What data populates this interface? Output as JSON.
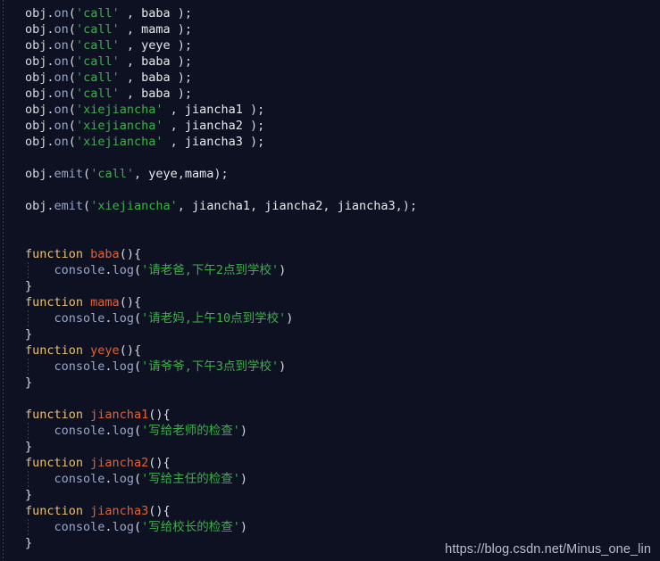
{
  "editor": {
    "theme": "dark-navy",
    "background_color": "#0d1122",
    "language": "javascript",
    "colors": {
      "foreground": "#d7dae3",
      "string": "#3fae4c",
      "keyword": "#e5c07b",
      "function_name": "#e06335",
      "property": "#9aa7c7",
      "indent_guide": "#7a84aa"
    }
  },
  "watermark": {
    "text": "https://blog.csdn.net/Minus_one_lin"
  },
  "code": {
    "lines": [
      {
        "n": 1,
        "indent": false,
        "tokens": [
          {
            "t": "plain",
            "v": "obj"
          },
          {
            "t": "punct",
            "v": "."
          },
          {
            "t": "prop",
            "v": "on"
          },
          {
            "t": "punct",
            "v": "("
          },
          {
            "t": "str",
            "v": "'call'"
          },
          {
            "t": "punct",
            "v": " , "
          },
          {
            "t": "ident",
            "v": "baba"
          },
          {
            "t": "punct",
            "v": " );"
          }
        ]
      },
      {
        "n": 2,
        "indent": false,
        "tokens": [
          {
            "t": "plain",
            "v": "obj"
          },
          {
            "t": "punct",
            "v": "."
          },
          {
            "t": "prop",
            "v": "on"
          },
          {
            "t": "punct",
            "v": "("
          },
          {
            "t": "str",
            "v": "'call'"
          },
          {
            "t": "punct",
            "v": " , "
          },
          {
            "t": "ident",
            "v": "mama"
          },
          {
            "t": "punct",
            "v": " );"
          }
        ]
      },
      {
        "n": 3,
        "indent": false,
        "tokens": [
          {
            "t": "plain",
            "v": "obj"
          },
          {
            "t": "punct",
            "v": "."
          },
          {
            "t": "prop",
            "v": "on"
          },
          {
            "t": "punct",
            "v": "("
          },
          {
            "t": "str",
            "v": "'call'"
          },
          {
            "t": "punct",
            "v": " , "
          },
          {
            "t": "ident",
            "v": "yeye"
          },
          {
            "t": "punct",
            "v": " );"
          }
        ]
      },
      {
        "n": 4,
        "indent": false,
        "tokens": [
          {
            "t": "plain",
            "v": "obj"
          },
          {
            "t": "punct",
            "v": "."
          },
          {
            "t": "prop",
            "v": "on"
          },
          {
            "t": "punct",
            "v": "("
          },
          {
            "t": "str",
            "v": "'call'"
          },
          {
            "t": "punct",
            "v": " , "
          },
          {
            "t": "ident",
            "v": "baba"
          },
          {
            "t": "punct",
            "v": " );"
          }
        ]
      },
      {
        "n": 5,
        "indent": false,
        "tokens": [
          {
            "t": "plain",
            "v": "obj"
          },
          {
            "t": "punct",
            "v": "."
          },
          {
            "t": "prop",
            "v": "on"
          },
          {
            "t": "punct",
            "v": "("
          },
          {
            "t": "str",
            "v": "'call'"
          },
          {
            "t": "punct",
            "v": " , "
          },
          {
            "t": "ident",
            "v": "baba"
          },
          {
            "t": "punct",
            "v": " );"
          }
        ]
      },
      {
        "n": 6,
        "indent": false,
        "tokens": [
          {
            "t": "plain",
            "v": "obj"
          },
          {
            "t": "punct",
            "v": "."
          },
          {
            "t": "prop",
            "v": "on"
          },
          {
            "t": "punct",
            "v": "("
          },
          {
            "t": "str",
            "v": "'call'"
          },
          {
            "t": "punct",
            "v": " , "
          },
          {
            "t": "ident",
            "v": "baba"
          },
          {
            "t": "punct",
            "v": " );"
          }
        ]
      },
      {
        "n": 7,
        "indent": false,
        "tokens": [
          {
            "t": "plain",
            "v": "obj"
          },
          {
            "t": "punct",
            "v": "."
          },
          {
            "t": "prop",
            "v": "on"
          },
          {
            "t": "punct",
            "v": "("
          },
          {
            "t": "str",
            "v": "'xiejiancha'"
          },
          {
            "t": "punct",
            "v": " , "
          },
          {
            "t": "ident",
            "v": "jiancha1"
          },
          {
            "t": "punct",
            "v": " );"
          }
        ]
      },
      {
        "n": 8,
        "indent": false,
        "tokens": [
          {
            "t": "plain",
            "v": "obj"
          },
          {
            "t": "punct",
            "v": "."
          },
          {
            "t": "prop",
            "v": "on"
          },
          {
            "t": "punct",
            "v": "("
          },
          {
            "t": "str",
            "v": "'xiejiancha'"
          },
          {
            "t": "punct",
            "v": " , "
          },
          {
            "t": "ident",
            "v": "jiancha2"
          },
          {
            "t": "punct",
            "v": " );"
          }
        ]
      },
      {
        "n": 9,
        "indent": false,
        "tokens": [
          {
            "t": "plain",
            "v": "obj"
          },
          {
            "t": "punct",
            "v": "."
          },
          {
            "t": "prop",
            "v": "on"
          },
          {
            "t": "punct",
            "v": "("
          },
          {
            "t": "str",
            "v": "'xiejiancha'"
          },
          {
            "t": "punct",
            "v": " , "
          },
          {
            "t": "ident",
            "v": "jiancha3"
          },
          {
            "t": "punct",
            "v": " );"
          }
        ]
      },
      {
        "n": 10,
        "indent": false,
        "tokens": []
      },
      {
        "n": 11,
        "indent": false,
        "tokens": [
          {
            "t": "plain",
            "v": "obj"
          },
          {
            "t": "punct",
            "v": "."
          },
          {
            "t": "prop",
            "v": "emit"
          },
          {
            "t": "punct",
            "v": "("
          },
          {
            "t": "str",
            "v": "'call'"
          },
          {
            "t": "punct",
            "v": ", "
          },
          {
            "t": "ident",
            "v": "yeye"
          },
          {
            "t": "punct",
            "v": ","
          },
          {
            "t": "ident",
            "v": "mama"
          },
          {
            "t": "punct",
            "v": ");"
          }
        ]
      },
      {
        "n": 12,
        "indent": false,
        "tokens": []
      },
      {
        "n": 13,
        "indent": false,
        "tokens": [
          {
            "t": "plain",
            "v": "obj"
          },
          {
            "t": "punct",
            "v": "."
          },
          {
            "t": "prop",
            "v": "emit"
          },
          {
            "t": "punct",
            "v": "("
          },
          {
            "t": "str",
            "v": "'xiejiancha'"
          },
          {
            "t": "punct",
            "v": ", "
          },
          {
            "t": "ident",
            "v": "jiancha1"
          },
          {
            "t": "punct",
            "v": ", "
          },
          {
            "t": "ident",
            "v": "jiancha2"
          },
          {
            "t": "punct",
            "v": ", "
          },
          {
            "t": "ident",
            "v": "jiancha3"
          },
          {
            "t": "punct",
            "v": ",);"
          }
        ]
      },
      {
        "n": 14,
        "indent": false,
        "tokens": []
      },
      {
        "n": 15,
        "indent": false,
        "tokens": []
      },
      {
        "n": 16,
        "indent": false,
        "tokens": [
          {
            "t": "kw",
            "v": "function"
          },
          {
            "t": "punct",
            "v": " "
          },
          {
            "t": "fn",
            "v": "baba"
          },
          {
            "t": "punct",
            "v": "(){"
          }
        ]
      },
      {
        "n": 17,
        "indent": true,
        "tokens": [
          {
            "t": "punct",
            "v": "    "
          },
          {
            "t": "prop",
            "v": "console"
          },
          {
            "t": "punct",
            "v": "."
          },
          {
            "t": "prop",
            "v": "log"
          },
          {
            "t": "punct",
            "v": "("
          },
          {
            "t": "str",
            "v": "'请老爸,下午2点到学校'"
          },
          {
            "t": "punct",
            "v": ")"
          }
        ]
      },
      {
        "n": 18,
        "indent": false,
        "tokens": [
          {
            "t": "punct",
            "v": "}"
          }
        ]
      },
      {
        "n": 19,
        "indent": false,
        "tokens": [
          {
            "t": "kw",
            "v": "function"
          },
          {
            "t": "punct",
            "v": " "
          },
          {
            "t": "fn",
            "v": "mama"
          },
          {
            "t": "punct",
            "v": "(){"
          }
        ]
      },
      {
        "n": 20,
        "indent": true,
        "tokens": [
          {
            "t": "punct",
            "v": "    "
          },
          {
            "t": "prop",
            "v": "console"
          },
          {
            "t": "punct",
            "v": "."
          },
          {
            "t": "prop",
            "v": "log"
          },
          {
            "t": "punct",
            "v": "("
          },
          {
            "t": "str",
            "v": "'请老妈,上午10点到学校'"
          },
          {
            "t": "punct",
            "v": ")"
          }
        ]
      },
      {
        "n": 21,
        "indent": false,
        "tokens": [
          {
            "t": "punct",
            "v": "}"
          }
        ]
      },
      {
        "n": 22,
        "indent": false,
        "tokens": [
          {
            "t": "kw",
            "v": "function"
          },
          {
            "t": "punct",
            "v": " "
          },
          {
            "t": "fn",
            "v": "yeye"
          },
          {
            "t": "punct",
            "v": "(){"
          }
        ]
      },
      {
        "n": 23,
        "indent": true,
        "tokens": [
          {
            "t": "punct",
            "v": "    "
          },
          {
            "t": "prop",
            "v": "console"
          },
          {
            "t": "punct",
            "v": "."
          },
          {
            "t": "prop",
            "v": "log"
          },
          {
            "t": "punct",
            "v": "("
          },
          {
            "t": "str",
            "v": "'请爷爷,下午3点到学校'"
          },
          {
            "t": "punct",
            "v": ")"
          }
        ]
      },
      {
        "n": 24,
        "indent": false,
        "tokens": [
          {
            "t": "punct",
            "v": "}"
          }
        ]
      },
      {
        "n": 25,
        "indent": false,
        "tokens": []
      },
      {
        "n": 26,
        "indent": false,
        "tokens": [
          {
            "t": "kw",
            "v": "function"
          },
          {
            "t": "punct",
            "v": " "
          },
          {
            "t": "fn",
            "v": "jiancha1"
          },
          {
            "t": "punct",
            "v": "(){"
          }
        ]
      },
      {
        "n": 27,
        "indent": true,
        "tokens": [
          {
            "t": "punct",
            "v": "    "
          },
          {
            "t": "prop",
            "v": "console"
          },
          {
            "t": "punct",
            "v": "."
          },
          {
            "t": "prop",
            "v": "log"
          },
          {
            "t": "punct",
            "v": "("
          },
          {
            "t": "str",
            "v": "'写给老师的检查'"
          },
          {
            "t": "punct",
            "v": ")"
          }
        ]
      },
      {
        "n": 28,
        "indent": false,
        "tokens": [
          {
            "t": "punct",
            "v": "}"
          }
        ]
      },
      {
        "n": 29,
        "indent": false,
        "tokens": [
          {
            "t": "kw",
            "v": "function"
          },
          {
            "t": "punct",
            "v": " "
          },
          {
            "t": "fn",
            "v": "jiancha2"
          },
          {
            "t": "punct",
            "v": "(){"
          }
        ]
      },
      {
        "n": 30,
        "indent": true,
        "tokens": [
          {
            "t": "punct",
            "v": "    "
          },
          {
            "t": "prop",
            "v": "console"
          },
          {
            "t": "punct",
            "v": "."
          },
          {
            "t": "prop",
            "v": "log"
          },
          {
            "t": "punct",
            "v": "("
          },
          {
            "t": "str",
            "v": "'写给主任的检查'"
          },
          {
            "t": "punct",
            "v": ")"
          }
        ]
      },
      {
        "n": 31,
        "indent": false,
        "tokens": [
          {
            "t": "punct",
            "v": "}"
          }
        ]
      },
      {
        "n": 32,
        "indent": false,
        "tokens": [
          {
            "t": "kw",
            "v": "function"
          },
          {
            "t": "punct",
            "v": " "
          },
          {
            "t": "fn",
            "v": "jiancha3"
          },
          {
            "t": "punct",
            "v": "(){"
          }
        ]
      },
      {
        "n": 33,
        "indent": true,
        "tokens": [
          {
            "t": "punct",
            "v": "    "
          },
          {
            "t": "prop",
            "v": "console"
          },
          {
            "t": "punct",
            "v": "."
          },
          {
            "t": "prop",
            "v": "log"
          },
          {
            "t": "punct",
            "v": "("
          },
          {
            "t": "str",
            "v": "'写给校长的检查'"
          },
          {
            "t": "punct",
            "v": ")"
          }
        ]
      },
      {
        "n": 34,
        "indent": false,
        "tokens": [
          {
            "t": "punct",
            "v": "}"
          }
        ]
      }
    ]
  }
}
